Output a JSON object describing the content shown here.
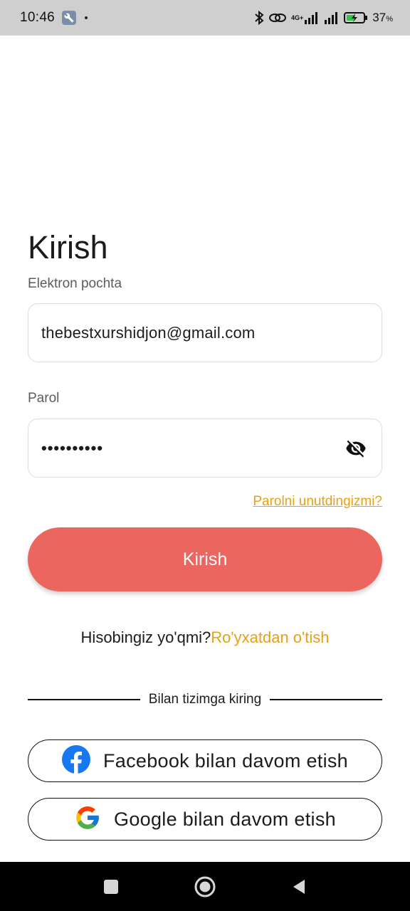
{
  "status_bar": {
    "time": "10:46",
    "network_label": "4G+",
    "battery_percent": "37",
    "battery_unit": "%",
    "icons": [
      "wrench-icon",
      "bluetooth-icon",
      "link-icon",
      "signal-icon",
      "signal-icon",
      "battery-charging-icon"
    ]
  },
  "login": {
    "title": "Kirish",
    "email_label": "Elektron pochta",
    "email_value": "thebestxurshidjon@gmail.com",
    "password_label": "Parol",
    "password_value": "••••••••••",
    "forgot_password": "Parolni unutdingizmi?",
    "submit_label": "Kirish",
    "no_account_text": "Hisobingiz yo'qmi?",
    "signup_link": "Ro'yxatdan o'tish",
    "divider_text": "Bilan tizimga kiring",
    "facebook_label": "Facebook bilan davom etish",
    "google_label": "Google bilan davom etish"
  },
  "colors": {
    "accent": "#e8a017",
    "primary_button": "#ea665e",
    "facebook": "#1877f2"
  },
  "nav_bar": {
    "icons": [
      "recents-square-icon",
      "home-circle-icon",
      "back-triangle-icon"
    ]
  }
}
